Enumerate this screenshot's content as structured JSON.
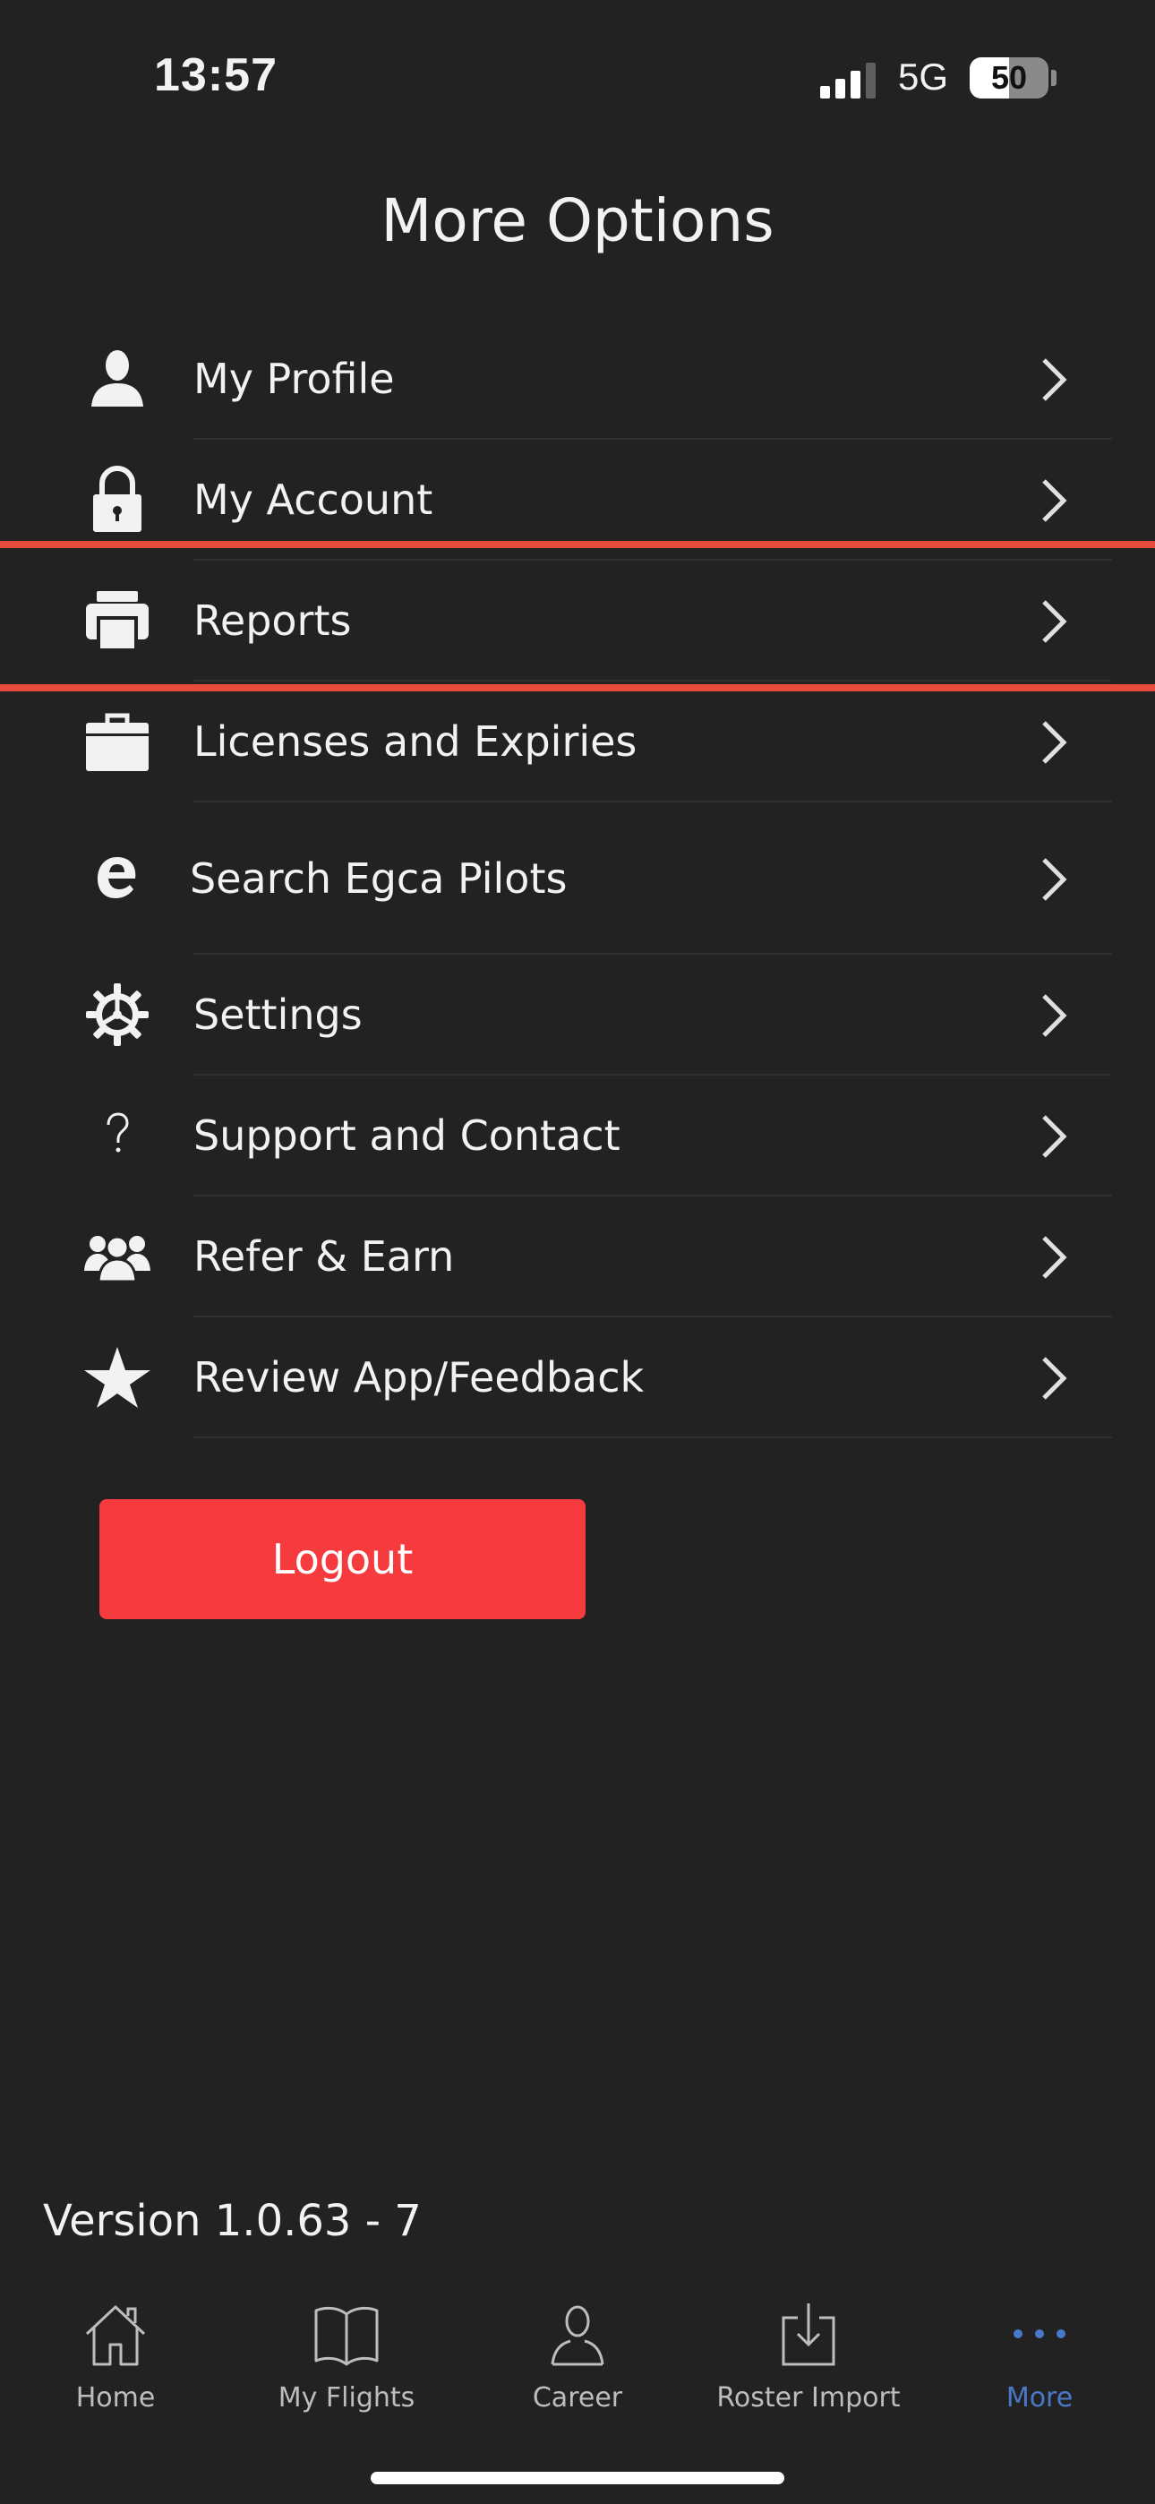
{
  "status_bar": {
    "time": "13:57",
    "network": "5G",
    "battery": "50",
    "battery_level": 0.5
  },
  "header": {
    "title": "More Options"
  },
  "menu": {
    "items": [
      {
        "label": "My Profile",
        "icon": "user-icon"
      },
      {
        "label": "My Account",
        "icon": "lock-icon"
      },
      {
        "label": "Reports",
        "icon": "printer-icon",
        "highlighted": true
      },
      {
        "label": "Licenses and Expiries",
        "icon": "briefcase-icon"
      },
      {
        "label": "Search Egca Pilots",
        "icon": "egca-e-icon"
      },
      {
        "label": "Settings",
        "icon": "gear-icon"
      },
      {
        "label": "Support and Contact",
        "icon": "question-icon"
      },
      {
        "label": "Refer & Earn",
        "icon": "group-icon"
      },
      {
        "label": "Review App/Feedback",
        "icon": "star-icon"
      }
    ]
  },
  "logout": {
    "label": "Logout",
    "color": "#f63b3e"
  },
  "version": "Version 1.0.63 - 7",
  "tab_bar": {
    "tabs": [
      {
        "label": "Home",
        "icon": "home-icon"
      },
      {
        "label": "My Flights",
        "icon": "book-icon"
      },
      {
        "label": "Career",
        "icon": "person-icon"
      },
      {
        "label": "Roster Import",
        "icon": "download-icon"
      },
      {
        "label": "More",
        "icon": "more-dots-icon",
        "active": true
      }
    ],
    "active_color": "#4a78c8"
  },
  "highlight_color": "#e94a3c"
}
